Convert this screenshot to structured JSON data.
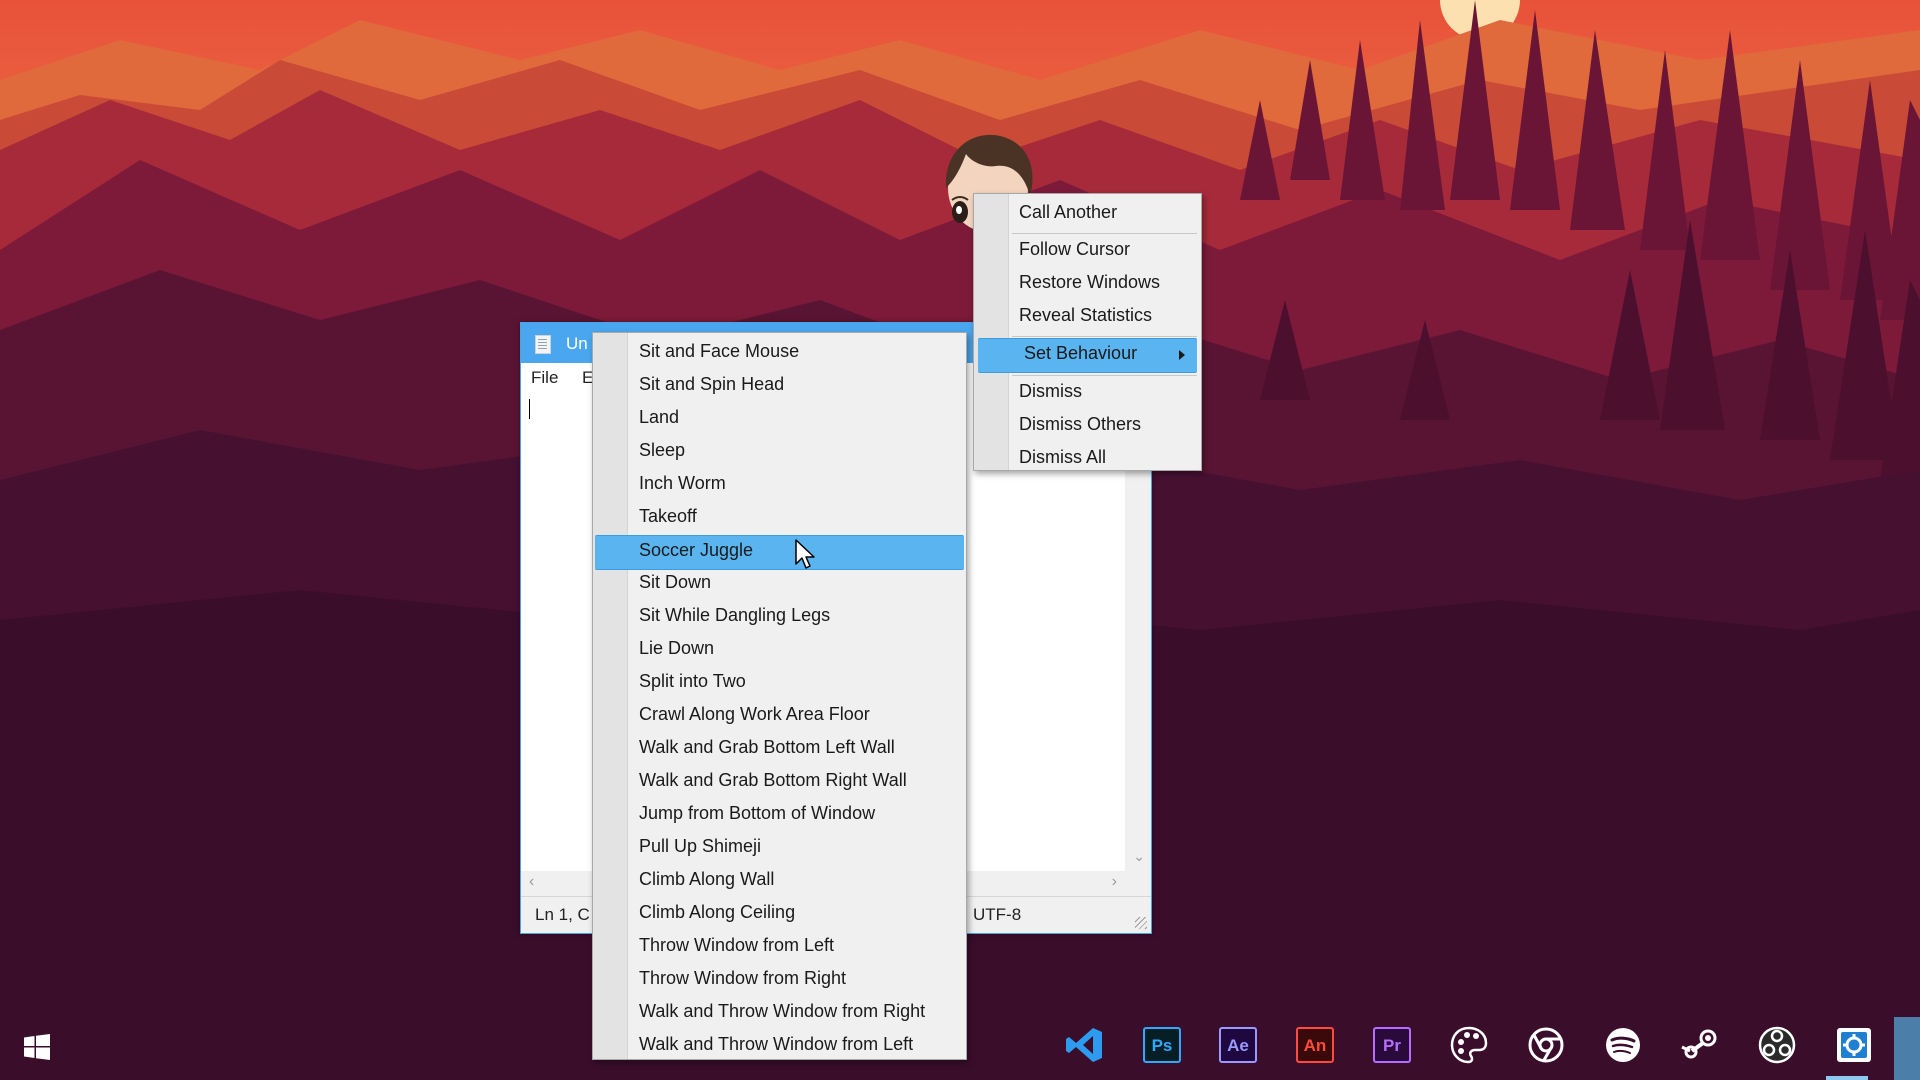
{
  "notepad": {
    "title": "Un",
    "menus": [
      "File",
      "E"
    ],
    "status_position": "Ln 1, C",
    "status_encoding": "UTF-8"
  },
  "context_menu": {
    "items": [
      {
        "label": "Call Another"
      },
      {
        "label": "Follow Cursor"
      },
      {
        "label": "Restore Windows"
      },
      {
        "label": "Reveal Statistics"
      },
      {
        "label": "Set Behaviour",
        "highlighted": true,
        "has_submenu": true
      },
      {
        "label": "Dismiss"
      },
      {
        "label": "Dismiss Others"
      },
      {
        "label": "Dismiss All"
      }
    ]
  },
  "behaviour_menu": {
    "items": [
      {
        "label": "Sit and Face Mouse"
      },
      {
        "label": "Sit and Spin Head"
      },
      {
        "label": "Land"
      },
      {
        "label": "Sleep"
      },
      {
        "label": "Inch Worm"
      },
      {
        "label": "Takeoff"
      },
      {
        "label": "Soccer Juggle",
        "highlighted": true
      },
      {
        "label": "Sit Down"
      },
      {
        "label": "Sit While Dangling Legs"
      },
      {
        "label": "Lie Down"
      },
      {
        "label": "Split into Two"
      },
      {
        "label": "Crawl Along Work Area Floor"
      },
      {
        "label": "Walk and Grab Bottom Left Wall"
      },
      {
        "label": "Walk and Grab Bottom Right Wall"
      },
      {
        "label": "Jump from Bottom of Window"
      },
      {
        "label": "Pull Up Shimeji"
      },
      {
        "label": "Climb Along Wall"
      },
      {
        "label": "Climb Along Ceiling"
      },
      {
        "label": "Throw Window from Left"
      },
      {
        "label": "Throw Window from Right"
      },
      {
        "label": "Walk and Throw Window from Right"
      },
      {
        "label": "Walk and Throw Window from Left"
      }
    ]
  },
  "taskbar": {
    "start_icon": "windows-logo-icon",
    "apps": [
      {
        "icon": "vscode-icon",
        "label": ""
      },
      {
        "icon": "photoshop-icon",
        "label": "Ps",
        "color": "#31a8ff"
      },
      {
        "icon": "after-effects-icon",
        "label": "Ae",
        "color": "#9999ff"
      },
      {
        "icon": "animate-icon",
        "label": "An",
        "color": "#ff4a3d"
      },
      {
        "icon": "premiere-icon",
        "label": "Pr",
        "color": "#b56dff"
      },
      {
        "icon": "palette-icon",
        "label": ""
      },
      {
        "icon": "chrome-icon",
        "label": ""
      },
      {
        "icon": "spotify-icon",
        "label": ""
      },
      {
        "icon": "steam-icon",
        "label": ""
      },
      {
        "icon": "obs-icon",
        "label": ""
      },
      {
        "icon": "shimeji-icon",
        "label": "",
        "active": true
      }
    ]
  },
  "colors": {
    "menu_highlight": "#5ab4f0",
    "titlebar": "#4aa7ef",
    "sky_top": "#e8523a",
    "sky_glow": "#f7a257",
    "ground": "#3a0d2b"
  }
}
